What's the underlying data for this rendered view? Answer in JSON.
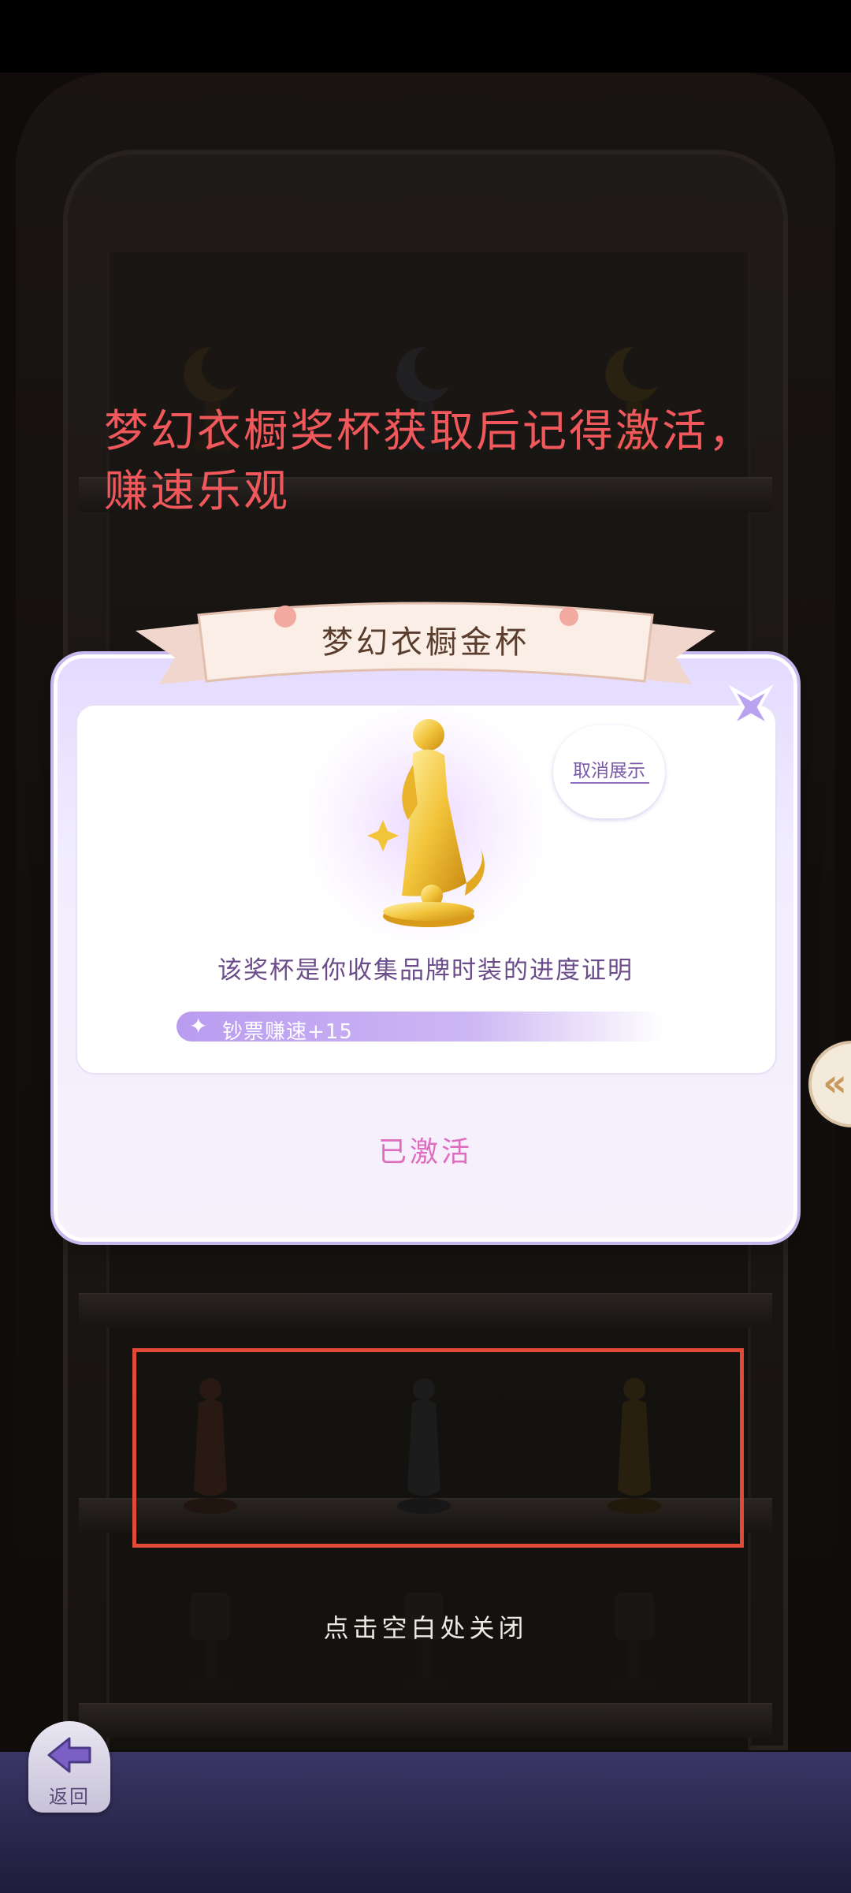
{
  "annotation": {
    "note": "梦幻衣橱奖杯获取后记得激活，赚速乐观"
  },
  "dialog": {
    "title": "梦幻衣橱金杯",
    "cancel_display": "取消展示",
    "description": "该奖杯是你收集品牌时装的进度证明",
    "bonus": "钞票赚速+15",
    "status": "已激活"
  },
  "hint": "点击空白处关闭",
  "nav": {
    "back_label": "返回"
  },
  "colors": {
    "annotation": "#f0585c",
    "highlight_border": "#e04a36",
    "activated": "#de6dc0",
    "dialog_border": "#c8b8f0"
  }
}
